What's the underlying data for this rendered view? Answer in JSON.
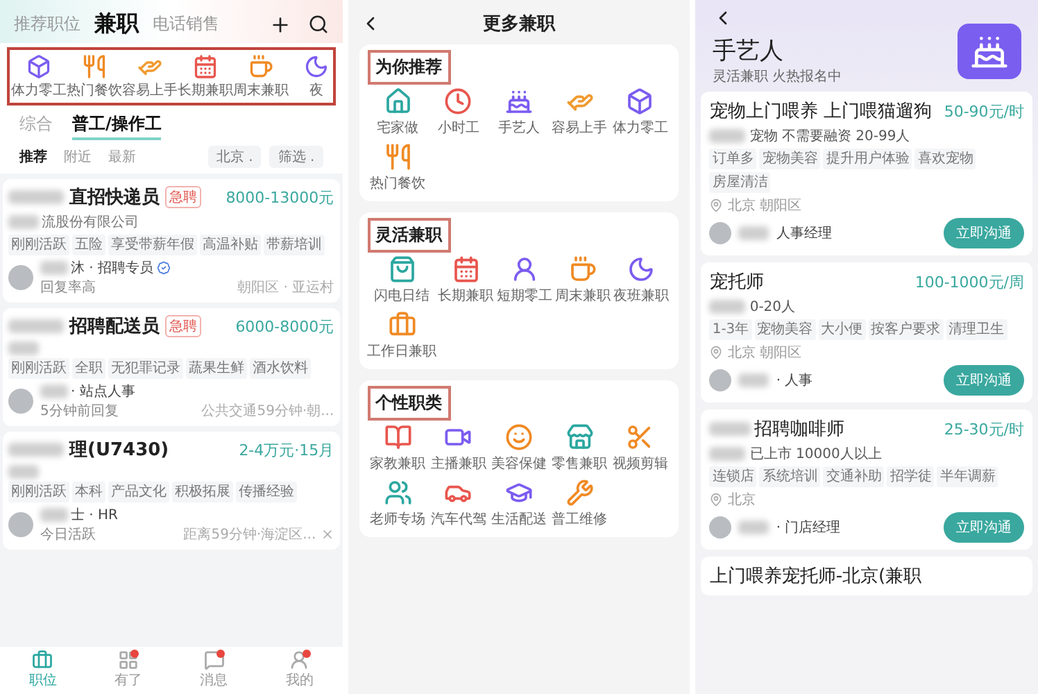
{
  "left": {
    "tabs": [
      {
        "label": "推荐职位",
        "selected": false
      },
      {
        "label": "兼职",
        "selected": true
      },
      {
        "label": "电话销售",
        "selected": false
      }
    ],
    "categories_highlighted": true,
    "categories": [
      "体力零工",
      "热门餐饮",
      "容易上手",
      "长期兼职",
      "周末兼职",
      "夜"
    ],
    "subtabs": [
      {
        "label": "综合",
        "selected": false
      },
      {
        "label": "普工/操作工",
        "selected": true
      }
    ],
    "sorts": [
      {
        "label": "推荐",
        "selected": true
      },
      {
        "label": "附近",
        "selected": false
      },
      {
        "label": "最新",
        "selected": false
      }
    ],
    "filters": [
      "北京 .",
      "筛选 ."
    ],
    "jobs": [
      {
        "redacted": true,
        "title": "直招快递员",
        "urgent": "急聘",
        "salary": "8000-13000元",
        "company": "流股份有限公司",
        "tags": [
          "刚刚活跃",
          "五险",
          "享受带薪年假",
          "高温补贴",
          "带薪培训"
        ],
        "recruiter": "沐 · 招聘专员",
        "verified": true,
        "status": "回复率高",
        "location": "朝阳区 · 亚运村",
        "closable": false
      },
      {
        "redacted": true,
        "title": "招聘配送员",
        "urgent": "急聘",
        "salary": "6000-8000元",
        "tags": [
          "刚刚活跃",
          "全职",
          "无犯罪记录",
          "蔬果生鲜",
          "酒水饮料"
        ],
        "recruiter": "· 站点人事",
        "verified": false,
        "status": "5分钟前回复",
        "location": "公共交通59分钟·朝...",
        "closable": false
      },
      {
        "redacted": true,
        "title": "理(U7430)",
        "salary": "2-4万元·15月",
        "tags": [
          "刚刚活跃",
          "本科",
          "产品文化",
          "积极拓展",
          "传播经验"
        ],
        "recruiter": "士 · HR",
        "verified": false,
        "status": "今日活跃",
        "location": "距离59分钟·海淀区...",
        "closable": true
      }
    ],
    "nav": [
      {
        "label": "职位",
        "selected": true,
        "dot": false
      },
      {
        "label": "有了",
        "selected": false,
        "dot": true
      },
      {
        "label": "消息",
        "selected": false,
        "dot": true
      },
      {
        "label": "我的",
        "selected": false,
        "dot": true
      }
    ]
  },
  "middle": {
    "title": "更多兼职",
    "sections": [
      {
        "title": "为你推荐",
        "highlighted": true,
        "items": [
          "宅家做",
          "小时工",
          "手艺人",
          "容易上手",
          "体力零工",
          "热门餐饮"
        ]
      },
      {
        "title": "灵活兼职",
        "highlighted": true,
        "items": [
          "闪电日结",
          "长期兼职",
          "短期零工",
          "周末兼职",
          "夜班兼职",
          "工作日兼职"
        ]
      },
      {
        "title": "个性职类",
        "highlighted": true,
        "items": [
          "家教兼职",
          "主播兼职",
          "美容保健",
          "零售兼职",
          "视频剪辑",
          "老师专场",
          "汽车代驾",
          "生活配送",
          "普工维修"
        ]
      }
    ]
  },
  "right": {
    "title": "手艺人",
    "subtitle": "灵活兼职 火热报名中",
    "jobs": [
      {
        "redacted": false,
        "title": "宠物上门喂养 上门喂猫遛狗",
        "salary": "50-90元/时",
        "info": "宠物 不需要融资 20-99人",
        "tags": [
          "订单多",
          "宠物美容",
          "提升用户体验",
          "喜欢宠物",
          "房屋清洁"
        ],
        "location": "北京 朝阳区",
        "recruiter": "人事经理",
        "button": "立即沟通"
      },
      {
        "redacted": false,
        "title": "宠托师",
        "salary": "100-1000元/周",
        "info": "0-20人",
        "tags": [
          "1-3年",
          "宠物美容",
          "大小便",
          "按客户要求",
          "清理卫生"
        ],
        "location": "北京 朝阳区",
        "recruiter": "· 人事",
        "button": "立即沟通"
      },
      {
        "redacted": true,
        "title": "招聘咖啡师",
        "salary": "25-30元/时",
        "info": "已上市 10000人以上",
        "tags": [
          "连锁店",
          "系统培训",
          "交通补助",
          "招学徒",
          "半年调薪"
        ],
        "location": "北京",
        "recruiter": "· 门店经理",
        "button": "立即沟通"
      },
      {
        "redacted": false,
        "title": "上门喂养宠托师-北京(兼职"
      }
    ]
  }
}
